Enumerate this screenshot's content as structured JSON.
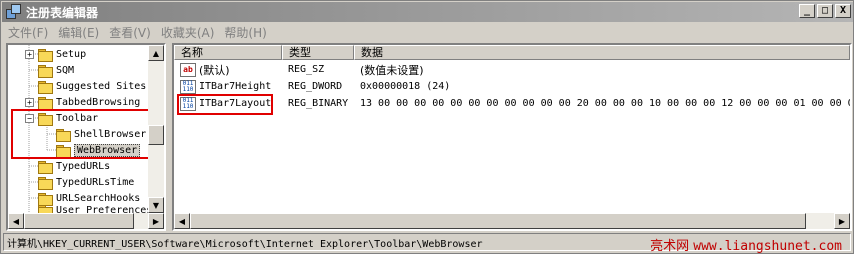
{
  "window": {
    "title": "注册表编辑器"
  },
  "window_buttons": {
    "minimize": "_",
    "maximize": "□",
    "close": "X"
  },
  "menu": [
    "文件(F)",
    "编辑(E)",
    "查看(V)",
    "收藏夹(A)",
    "帮助(H)"
  ],
  "tree": {
    "items": [
      {
        "label": "Setup",
        "expander": "+"
      },
      {
        "label": "SQM",
        "expander": ""
      },
      {
        "label": "Suggested Sites",
        "expander": ""
      },
      {
        "label": "TabbedBrowsing",
        "expander": "+"
      },
      {
        "label": "Toolbar",
        "expander": "−"
      },
      {
        "label": "ShellBrowser",
        "expander": ""
      },
      {
        "label": "WebBrowser",
        "expander": ""
      },
      {
        "label": "TypedURLs",
        "expander": ""
      },
      {
        "label": "TypedURLsTime",
        "expander": ""
      },
      {
        "label": "URLSearchHooks",
        "expander": ""
      },
      {
        "label": "User Preferences",
        "expander": ""
      }
    ],
    "selected": "WebBrowser"
  },
  "list": {
    "columns": {
      "name": "名称",
      "type": "类型",
      "data": "数据"
    },
    "rows": [
      {
        "icon": "ab",
        "name": "(默认)",
        "type": "REG_SZ",
        "data": "(数值未设置)"
      },
      {
        "icon": "bin",
        "name": "ITBar7Height",
        "type": "REG_DWORD",
        "data": "0x00000018 (24)"
      },
      {
        "icon": "bin",
        "name": "ITBar7Layout",
        "type": "REG_BINARY",
        "data": "13 00 00 00 00 00 00 00 00 00 00 00 20 00 00 00 10 00 00 00 12 00 00 00 01 00 00 00"
      }
    ]
  },
  "status": {
    "path": "计算机\\HKEY_CURRENT_USER\\Software\\Microsoft\\Internet Explorer\\Toolbar\\WebBrowser",
    "watermark_site": "亮术网",
    "watermark_url": "www.liangshunet.com"
  },
  "colors": {
    "highlight_box": "#e00000",
    "watermark": "#c00000"
  }
}
